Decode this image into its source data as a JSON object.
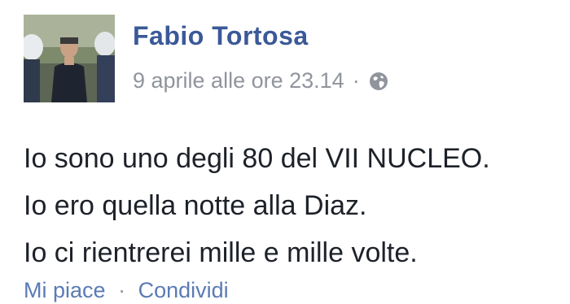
{
  "post": {
    "author": "Fabio Tortosa",
    "timestamp": "9 aprile alle ore 23.14",
    "separator": "·",
    "privacy_icon": "globe-icon",
    "lines": [
      "Io sono uno degli 80 del VII NUCLEO.",
      "Io ero quella notte alla Diaz.",
      "Io ci rientrerei mille e mille volte."
    ],
    "actions": {
      "like": "Mi piace",
      "separator": "·",
      "share": "Condividi"
    }
  },
  "colors": {
    "author": "#3b5998",
    "meta": "#90949c",
    "text": "#1d2129",
    "link": "#5b7bb4"
  }
}
